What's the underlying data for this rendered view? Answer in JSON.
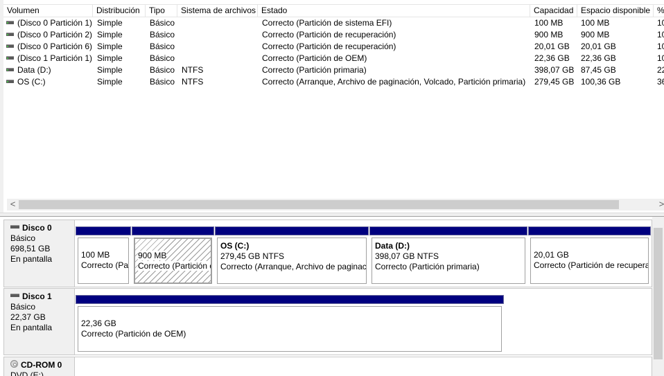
{
  "columns": [
    "Volumen",
    "Distribución",
    "Tipo",
    "Sistema de archivos",
    "Estado",
    "Capacidad",
    "Espacio disponible",
    "%"
  ],
  "volumes": [
    {
      "name": "(Disco 0 Partición 1)",
      "layout": "Simple",
      "type": "Básico",
      "fs": "",
      "status": "Correcto (Partición de sistema EFI)",
      "capacity": "100 MB",
      "free": "100 MB",
      "pct": "10"
    },
    {
      "name": "(Disco 0 Partición 2)",
      "layout": "Simple",
      "type": "Básico",
      "fs": "",
      "status": "Correcto (Partición de recuperación)",
      "capacity": "900 MB",
      "free": "900 MB",
      "pct": "10"
    },
    {
      "name": "(Disco 0 Partición 6)",
      "layout": "Simple",
      "type": "Básico",
      "fs": "",
      "status": "Correcto (Partición de recuperación)",
      "capacity": "20,01 GB",
      "free": "20,01 GB",
      "pct": "10"
    },
    {
      "name": "(Disco 1 Partición 1)",
      "layout": "Simple",
      "type": "Básico",
      "fs": "",
      "status": "Correcto (Partición de OEM)",
      "capacity": "22,36 GB",
      "free": "22,36 GB",
      "pct": "10"
    },
    {
      "name": "Data (D:)",
      "layout": "Simple",
      "type": "Básico",
      "fs": "NTFS",
      "status": "Correcto (Partición primaria)",
      "capacity": "398,07 GB",
      "free": "87,45 GB",
      "pct": "22"
    },
    {
      "name": "OS (C:)",
      "layout": "Simple",
      "type": "Básico",
      "fs": "NTFS",
      "status": "Correcto (Arranque, Archivo de paginación, Volcado, Partición primaria)",
      "capacity": "279,45 GB",
      "free": "100,36 GB",
      "pct": "36"
    }
  ],
  "scroll": {
    "left": "<",
    "right": ">"
  },
  "disks": [
    {
      "name": "Disco 0",
      "kind": "Básico",
      "size": "698,51 GB",
      "state": "En pantalla",
      "partitions": [
        {
          "vol": "",
          "size": "100 MB",
          "status": "Correcto (Partición de sistema EFI)"
        },
        {
          "vol": "",
          "size": "900 MB",
          "status": "Correcto (Partición de recuperación)"
        },
        {
          "vol": "OS  (C:)",
          "size": "279,45 GB NTFS",
          "status": "Correcto (Arranque, Archivo de paginación, Volcado, Partición primaria)"
        },
        {
          "vol": "Data  (D:)",
          "size": "398,07 GB NTFS",
          "status": "Correcto (Partición primaria)"
        },
        {
          "vol": "",
          "size": "20,01 GB",
          "status": "Correcto (Partición de recuperación)"
        }
      ]
    },
    {
      "name": "Disco 1",
      "kind": "Básico",
      "size": "22,37 GB",
      "state": "En pantalla",
      "partitions": [
        {
          "vol": "",
          "size": "22,36 GB",
          "status": "Correcto (Partición de OEM)"
        }
      ]
    },
    {
      "name": "CD-ROM 0",
      "kind": "DVD (E:)"
    }
  ]
}
